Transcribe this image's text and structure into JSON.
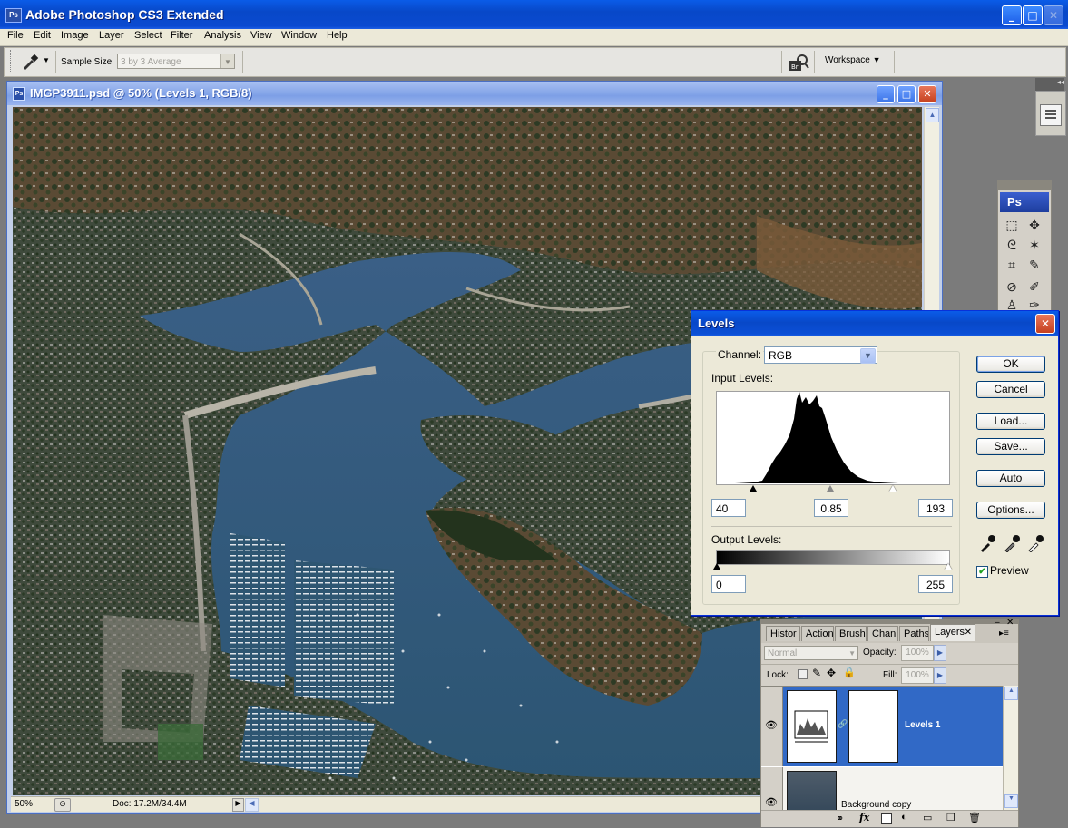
{
  "app": {
    "title": "Adobe Photoshop CS3 Extended",
    "logo": "Ps"
  },
  "window_controls": {
    "minimize": "_",
    "maximize": "□",
    "close": "✕"
  },
  "menubar": {
    "items": [
      "File",
      "Edit",
      "Image",
      "Layer",
      "Select",
      "Filter",
      "Analysis",
      "View",
      "Window",
      "Help"
    ]
  },
  "options_bar": {
    "tool_icon": "eyedropper-icon",
    "sample_size_label": "Sample Size:",
    "sample_size_value": "3 by 3 Average",
    "workspace_label": "Workspace",
    "bridge_icon": "bridge-icon"
  },
  "document": {
    "title": "IMGP3911.psd @ 50% (Levels 1, RGB/8)",
    "zoom": "50%",
    "doc_info": "Doc: 17.2M/34.4M"
  },
  "levels_dialog": {
    "title": "Levels",
    "channel_label": "Channel:",
    "channel_value": "RGB",
    "input_levels_label": "Input Levels:",
    "input_black": "40",
    "input_gamma": "0.85",
    "input_white": "193",
    "output_levels_label": "Output Levels:",
    "output_black": "0",
    "output_white": "255",
    "buttons": {
      "ok": "OK",
      "cancel": "Cancel",
      "load": "Load...",
      "save": "Save...",
      "auto": "Auto",
      "options": "Options..."
    },
    "preview_label": "Preview",
    "preview_checked": true
  },
  "layers_panel": {
    "tabs": [
      "Histor",
      "Action",
      "Brushe",
      "Chann",
      "Paths",
      "Layers"
    ],
    "active_tab": "Layers",
    "blend_mode": "Normal",
    "opacity_label": "Opacity:",
    "opacity_value": "100%",
    "lock_label": "Lock:",
    "fill_label": "Fill:",
    "fill_value": "100%",
    "layers": [
      {
        "name": "Levels 1",
        "selected": true
      },
      {
        "name": "Background copy",
        "selected": false
      }
    ]
  },
  "toolbox": {
    "header": "Ps"
  },
  "colors": {
    "xp_blue": "#0a5ce8",
    "selection_blue": "#3169c6",
    "panel_gray": "#d4d0c8",
    "dialog_bg": "#ece9d8"
  }
}
